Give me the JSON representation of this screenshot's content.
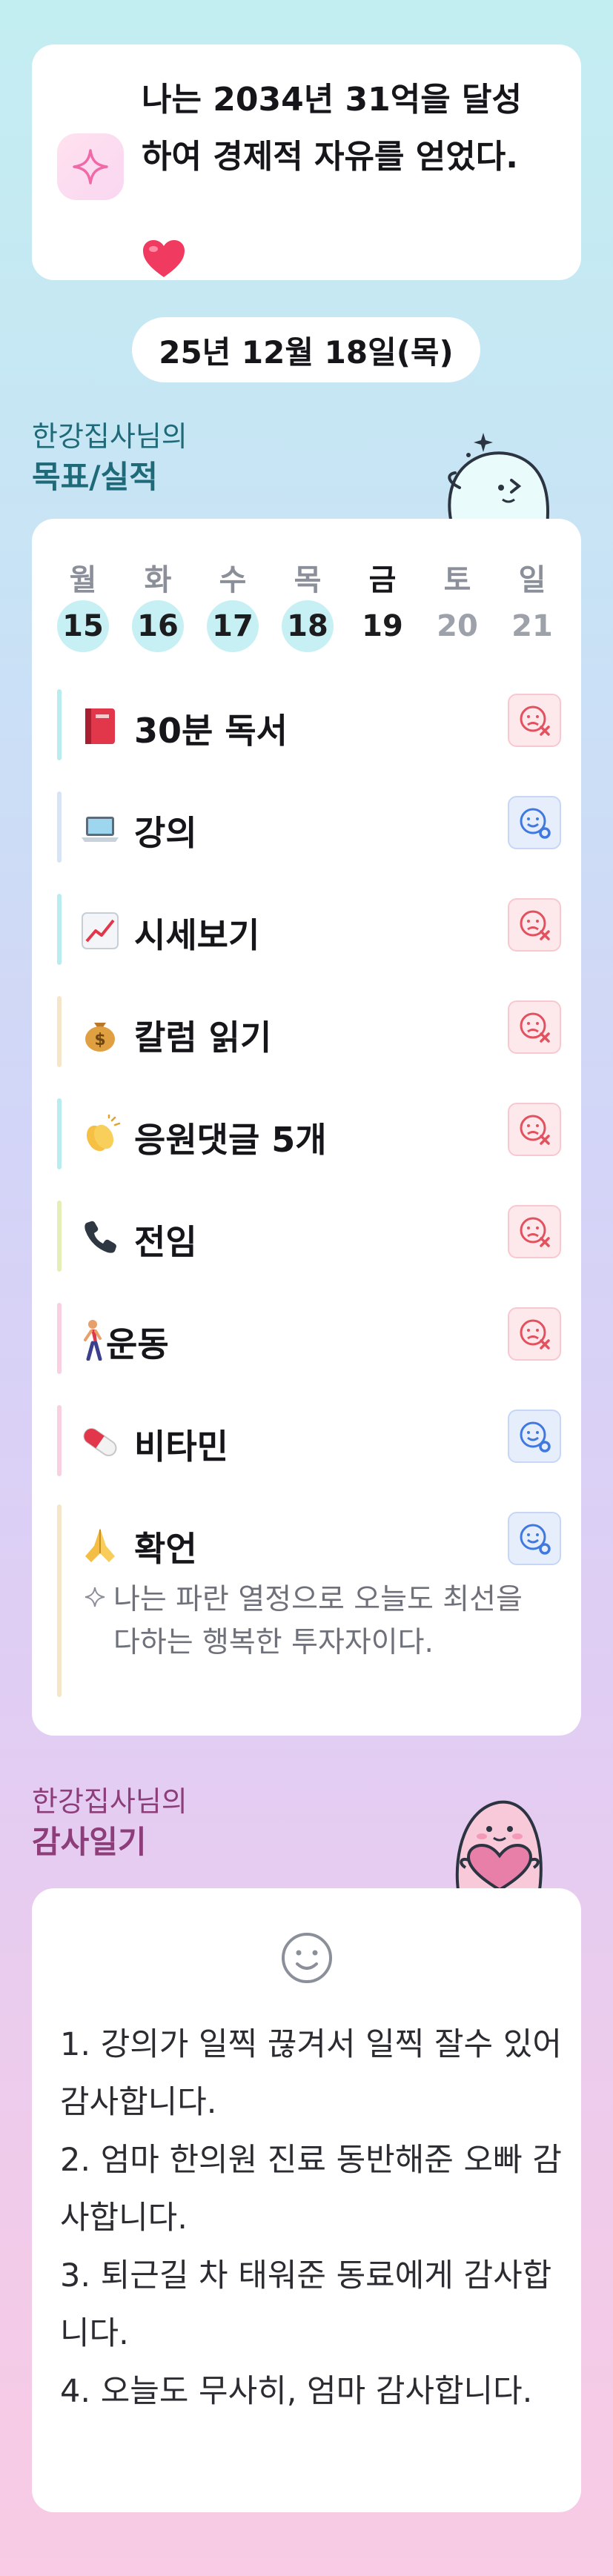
{
  "goal": {
    "text": "나는 2034년 31억을 달성\n하여 경제적 자유를 얻었다.",
    "icons": {
      "badge": "sparkle-icon",
      "heart": "heart-icon"
    }
  },
  "date": "25년 12월 18일(목)",
  "tracker_section": {
    "subtitle": "한강집사님의",
    "title": "목표/실적",
    "mascot": "ghost-mascot-icon"
  },
  "week": {
    "days": [
      {
        "name": "월",
        "num": "15"
      },
      {
        "name": "화",
        "num": "16"
      },
      {
        "name": "수",
        "num": "17"
      },
      {
        "name": "목",
        "num": "18"
      },
      {
        "name": "금",
        "num": "19"
      },
      {
        "name": "토",
        "num": "20"
      },
      {
        "name": "일",
        "num": "21"
      }
    ]
  },
  "habits": [
    {
      "label": "30분 독서",
      "emoji": "book-icon",
      "status": "fail",
      "bar": "#b9ecef"
    },
    {
      "label": "강의",
      "emoji": "laptop-icon",
      "status": "ok",
      "bar": "#d6e4f5"
    },
    {
      "label": "시세보기",
      "emoji": "chart-up-icon",
      "status": "fail",
      "bar": "#b9ecef"
    },
    {
      "label": "칼럼 읽기",
      "emoji": "money-bag-icon",
      "status": "fail",
      "bar": "#f5e6c9"
    },
    {
      "label": "응원댓글 5개",
      "emoji": "clapping-hands-icon",
      "status": "fail",
      "bar": "#b9ecef"
    },
    {
      "label": "전임",
      "emoji": "phone-icon",
      "status": "fail",
      "bar": "#e3efb7"
    },
    {
      "label": "운동",
      "emoji": "walking-person-icon",
      "status": "fail",
      "bar": "#f8d0e2"
    },
    {
      "label": "비타민",
      "emoji": "pill-icon",
      "status": "ok",
      "bar": "#f8d0e2"
    },
    {
      "label": "확언",
      "emoji": "praying-hands-icon",
      "status": "ok",
      "bar": "#f5e6c9"
    }
  ],
  "affirmation": "나는 파란 열정으로 오늘도 최선을 다하는 행복한 투자자이다.",
  "gratitude_section": {
    "subtitle": "한강집사님의",
    "title": "감사일기",
    "mascot": "heart-mascot-icon"
  },
  "gratitude": [
    "1. 강의가 일찍 끊겨서 일찍 잘수 있어 감사합니다.",
    "2. 엄마 한의원 진료 동반해준 오빠 감사합니다.",
    "3. 퇴근길 차 태워준 동료에게 감사합니다.",
    "4. 오늘도 무사히, 엄마 감사합니다."
  ],
  "colors": {
    "tracker_title": "#1e6a78",
    "gratitude_title": "#8c3d7a",
    "done_day": "#c7f0f4",
    "fail": "#e2515e",
    "ok": "#3f79e0"
  }
}
